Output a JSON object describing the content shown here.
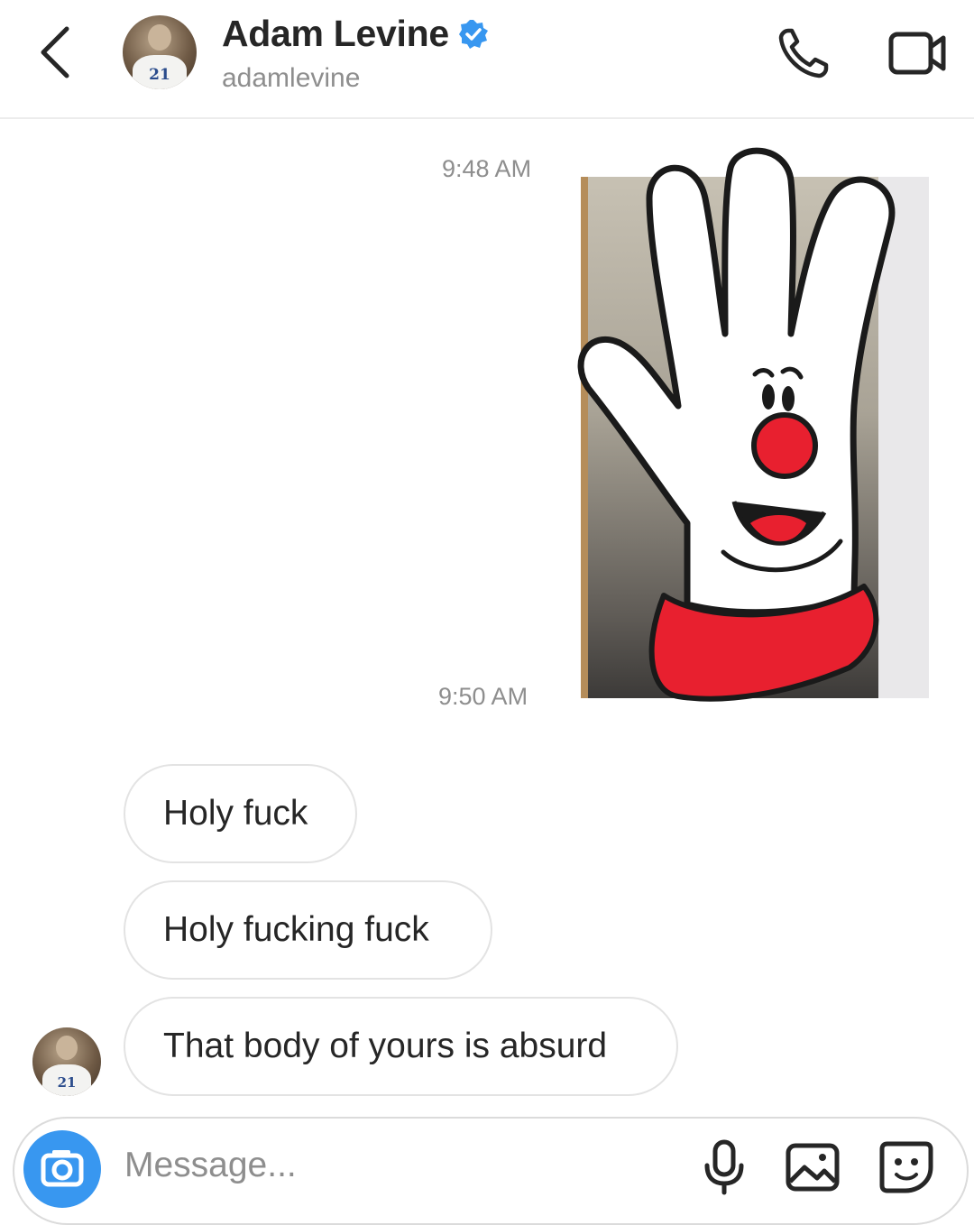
{
  "header": {
    "title": "Adam Levine",
    "handle": "adamlevine",
    "verified": true,
    "avatar_jersey_number": "21",
    "icons": {
      "back": "chevron-left-icon",
      "verified": "verified-badge-icon",
      "call": "phone-icon",
      "video": "video-camera-icon"
    }
  },
  "thread": {
    "timestamps": [
      "9:48 AM",
      "9:50 AM"
    ],
    "messages": [
      {
        "text": "Holy fuck"
      },
      {
        "text": "Holy fucking fuck"
      },
      {
        "text": "That body of yours is absurd"
      }
    ],
    "chat_avatar_jersey_number": "21"
  },
  "composer": {
    "placeholder": "Message...",
    "icons": {
      "camera": "camera-icon",
      "mic": "microphone-icon",
      "gallery": "image-icon",
      "sticker": "sticker-icon"
    }
  },
  "colors": {
    "accent": "#3897f0",
    "text": "#262626",
    "secondary_text": "#8e8e8e",
    "glove_red": "#e8202f"
  }
}
